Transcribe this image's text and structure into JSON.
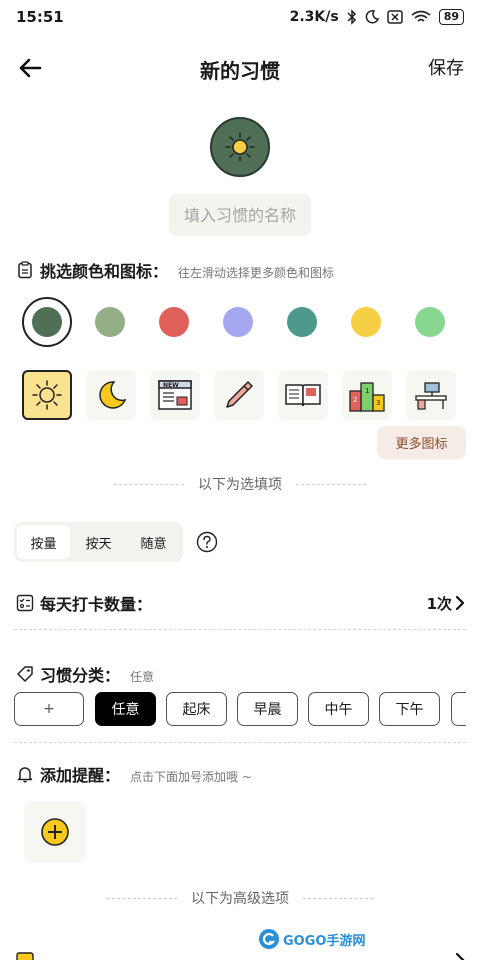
{
  "status_bar": {
    "time": "15:51",
    "network_speed": "2.3K/s",
    "battery": "89",
    "icons": [
      "moon-icon",
      "bluetooth-icon",
      "sim-icon",
      "wifi-icon",
      "battery-icon"
    ]
  },
  "nav": {
    "title": "新的习惯",
    "save_label": "保存",
    "back_icon": "arrow-left-icon"
  },
  "habit": {
    "icon": "sun-icon",
    "icon_color": "#4f7056",
    "name_placeholder": "填入习惯的名称"
  },
  "picker": {
    "title": "挑选颜色和图标：",
    "hint": "往左滑动选择更多颜色和图标",
    "colors": [
      "#4f7056",
      "#93ae85",
      "#e0605c",
      "#a5a8f1",
      "#4d9a8d",
      "#f6cf45",
      "#88d791"
    ],
    "selected_color_index": 0,
    "icons": [
      "sun-icon",
      "moon-icon",
      "newspaper-icon",
      "pencil-icon",
      "book-icon",
      "podium-icon",
      "desk-icon"
    ],
    "selected_icon_index": 0,
    "more_icons_label": "更多图标"
  },
  "optional_divider": "以下为选填项",
  "mode_tabs": {
    "items": [
      "按量",
      "按天",
      "随意"
    ],
    "active_index": 0
  },
  "daily_count": {
    "title": "每天打卡数量：",
    "value": "1次"
  },
  "category": {
    "title": "习惯分类：",
    "current": "任意",
    "add_label": "+",
    "chips": [
      "任意",
      "起床",
      "早晨",
      "中午",
      "下午"
    ],
    "active_index": 0
  },
  "reminder": {
    "title": "添加提醒：",
    "hint": "点击下面加号添加哦 ~"
  },
  "advanced_divider": "以下为高级选项",
  "watermark": "GOGO手游网",
  "colors": {
    "accent": "#000000",
    "chip_border": "#555555",
    "more_btn_bg": "#f6ece6",
    "more_btn_text": "#8a4a2c",
    "plus_yellow": "#f8c81c"
  }
}
